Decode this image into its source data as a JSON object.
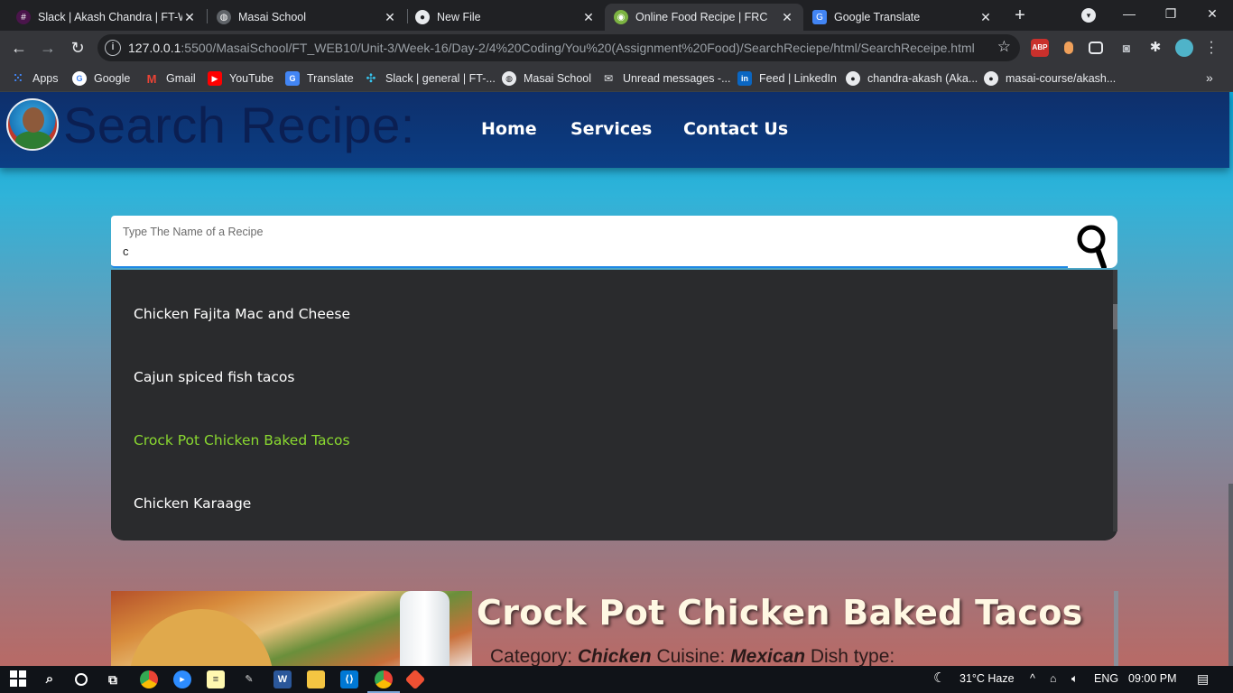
{
  "browser": {
    "tabs": [
      {
        "title": "Slack | Akash Chandra | FT-WE",
        "icon": "slack-icon",
        "active": false
      },
      {
        "title": "Masai School",
        "icon": "globe-icon",
        "active": false
      },
      {
        "title": "New File",
        "icon": "github-icon",
        "active": false
      },
      {
        "title": "Online Food Recipe | FRC",
        "icon": "recipe-icon",
        "active": true
      },
      {
        "title": "Google Translate",
        "icon": "translate-icon",
        "active": false
      }
    ],
    "url_host": "127.0.0.1",
    "url_rest": ":5500/MasaiSchool/FT_WEB10/Unit-3/Week-16/Day-2/4%20Coding/You%20(Assignment%20Food)/SearchReciepe/html/SearchReceipe.html",
    "extension_abp": "ABP",
    "bookmarks": [
      {
        "label": "Apps",
        "icon": "apps-grid-icon"
      },
      {
        "label": "Google",
        "icon": "google-icon"
      },
      {
        "label": "Gmail",
        "icon": "gmail-icon"
      },
      {
        "label": "YouTube",
        "icon": "youtube-icon"
      },
      {
        "label": "Translate",
        "icon": "translate-icon"
      },
      {
        "label": "Slack | general | FT-...",
        "icon": "slack-icon"
      },
      {
        "label": "Masai School",
        "icon": "globe-icon"
      },
      {
        "label": "Unread messages -...",
        "icon": "mail-icon"
      },
      {
        "label": "Feed | LinkedIn",
        "icon": "linkedin-icon"
      },
      {
        "label": "chandra-akash (Aka...",
        "icon": "github-icon"
      },
      {
        "label": "masai-course/akash...",
        "icon": "github-icon"
      }
    ]
  },
  "site": {
    "title": "Search Recipe:",
    "nav": [
      "Home",
      "Services",
      "Contact Us"
    ],
    "search": {
      "label": "Type The Name of a Recipe",
      "value": "c"
    },
    "suggestions": [
      {
        "text": "Chicken Fajita Mac and Cheese",
        "highlighted": false
      },
      {
        "text": "Cajun spiced fish tacos",
        "highlighted": false
      },
      {
        "text": "Crock Pot Chicken Baked Tacos",
        "highlighted": true
      },
      {
        "text": "Chicken Karaage",
        "highlighted": false
      }
    ],
    "recipe": {
      "title": "Crock Pot Chicken Baked Tacos",
      "category_label": "Category:",
      "category": "Chicken",
      "cuisine_label": "Cuisine:",
      "cuisine": "Mexican",
      "dish_type_label": "Dish type:"
    }
  },
  "taskbar": {
    "weather": "31°C  Haze",
    "language": "ENG",
    "time": "09:00 PM"
  },
  "colors": {
    "navbar": "#0b3e85",
    "highlight": "#8ad930",
    "dropdown": "#2a2b2d"
  }
}
